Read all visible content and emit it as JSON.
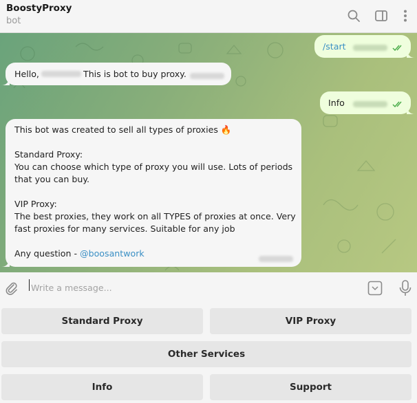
{
  "header": {
    "title": "BoostyProxy",
    "subtitle": "bot",
    "icons": [
      "search-icon",
      "sidebar-toggle-icon",
      "more-vertical-icon"
    ]
  },
  "messages": [
    {
      "direction": "out",
      "text": "/start",
      "is_command": true,
      "time": "blurred",
      "status": "read"
    },
    {
      "direction": "in",
      "greeting": "Hello,",
      "name": "blurred",
      "text": "This is bot to buy proxy.",
      "time": "blurred"
    },
    {
      "direction": "out",
      "text": "Info",
      "time": "blurred",
      "status": "read"
    },
    {
      "direction": "in",
      "lines": [
        "This bot was created to sell all types of proxies 🔥",
        "",
        "Standard Proxy:",
        "You can choose which type of proxy you will use. Lots of periods",
        "that you can buy.",
        "",
        "VIP Proxy:",
        "The best proxies, they work on all TYPES of proxies at once. Very",
        "fast proxies for many services. Suitable for any job",
        ""
      ],
      "contact_prefix": "Any question - ",
      "contact_link": "@boosantwork",
      "time": "blurred"
    }
  ],
  "composer": {
    "placeholder": "Write a message...",
    "value": "",
    "icons": [
      "attach-icon",
      "keyboard-toggle-icon",
      "microphone-icon"
    ]
  },
  "keyboard": {
    "rows": [
      [
        "Standard Proxy",
        "VIP Proxy"
      ],
      [
        "Other Services"
      ],
      [
        "Info",
        "Support"
      ]
    ]
  },
  "colors": {
    "link": "#3a8fc4",
    "check": "#4fae4e",
    "outgoing_bubble": "#effedd",
    "incoming_bubble": "#f6f6f6"
  }
}
